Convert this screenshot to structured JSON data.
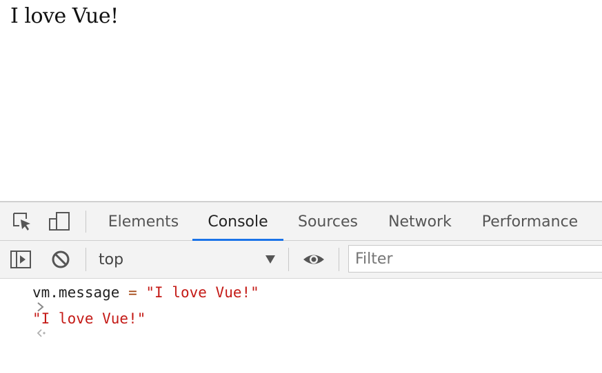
{
  "page": {
    "heading": "I love Vue!"
  },
  "devtools": {
    "tabs": [
      {
        "label": "Elements",
        "active": false
      },
      {
        "label": "Console",
        "active": true
      },
      {
        "label": "Sources",
        "active": false
      },
      {
        "label": "Network",
        "active": false
      },
      {
        "label": "Performance",
        "active": false
      }
    ],
    "toolbar_icons": [
      "inspect-element-icon",
      "device-toolbar-icon"
    ],
    "console_toolbar": {
      "sidebar_icon": "console-sidebar-icon",
      "clear_icon": "clear-console-icon",
      "context": "top",
      "live_expression_icon": "eye-icon",
      "filter_placeholder": "Filter"
    },
    "console": {
      "input": {
        "prompt": ">",
        "identifier": "vm.message",
        "operator": "=",
        "value": "\"I love Vue!\""
      },
      "output": {
        "prompt": "<",
        "value": "\"I love Vue!\""
      }
    },
    "accent_color": "#1a73e8",
    "string_color": "#c41a16"
  }
}
